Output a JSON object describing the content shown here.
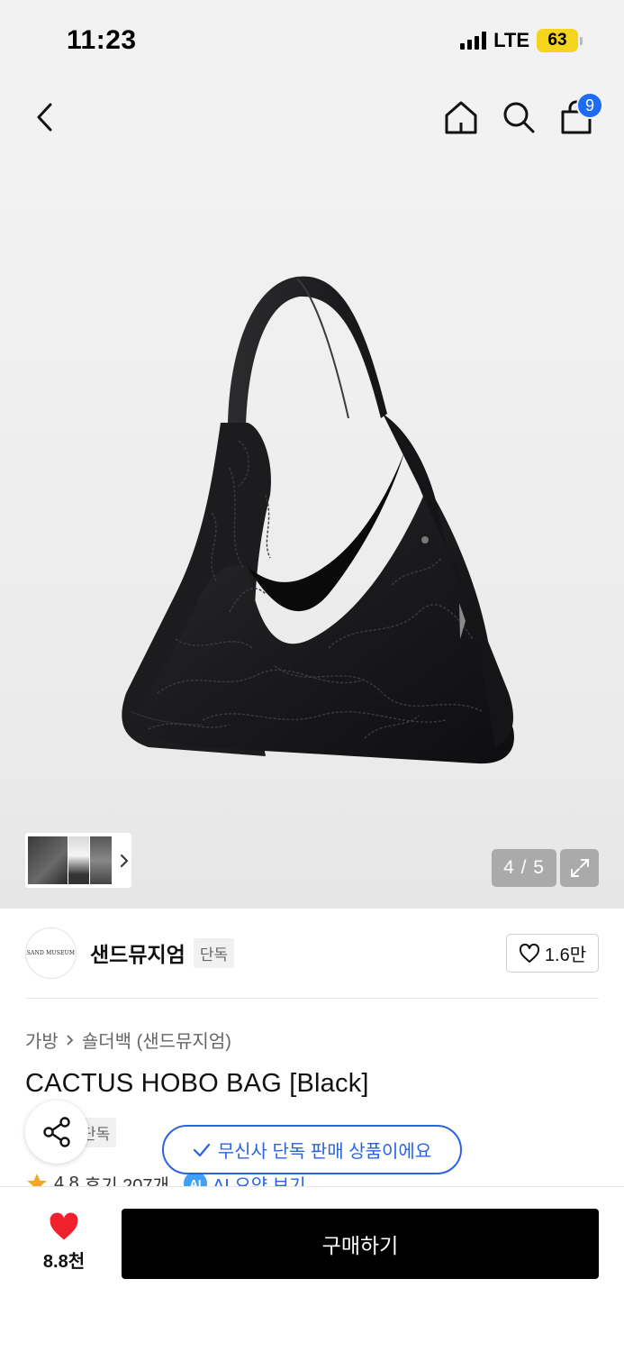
{
  "status_bar": {
    "time": "11:23",
    "network": "LTE",
    "battery": "63"
  },
  "nav": {
    "cart_count": "9",
    "icons": [
      "back-icon",
      "home-icon",
      "search-icon",
      "shopping-bag-icon"
    ]
  },
  "gallery": {
    "counter": "4 / 5",
    "current_index": 4,
    "total": 5
  },
  "brand": {
    "logo_text": "SAND MUSEUM",
    "name": "샌드뮤지엄",
    "tag": "단독",
    "like_count": "1.6만"
  },
  "breadcrumb": {
    "category": "가방",
    "subcategory": "숄더백 (샌드뮤지엄)"
  },
  "product": {
    "title": "CACTUS HOBO BAG [Black]",
    "tag": "단독"
  },
  "notice": {
    "text": "무신사 단독 판매 상품이에요"
  },
  "rating": {
    "score": "4.8",
    "reviews": "후기 207개",
    "ai_badge": "AI",
    "ai_link": "AI 요약 보기"
  },
  "bottom_bar": {
    "wish_count": "8.8천",
    "buy_label": "구매하기"
  },
  "colors": {
    "accent_blue": "#2b63dd",
    "badge_blue": "#1e6bf5",
    "heart_red": "#f0212d",
    "battery_yellow": "#f5d41e",
    "buy_button": "#000000"
  }
}
